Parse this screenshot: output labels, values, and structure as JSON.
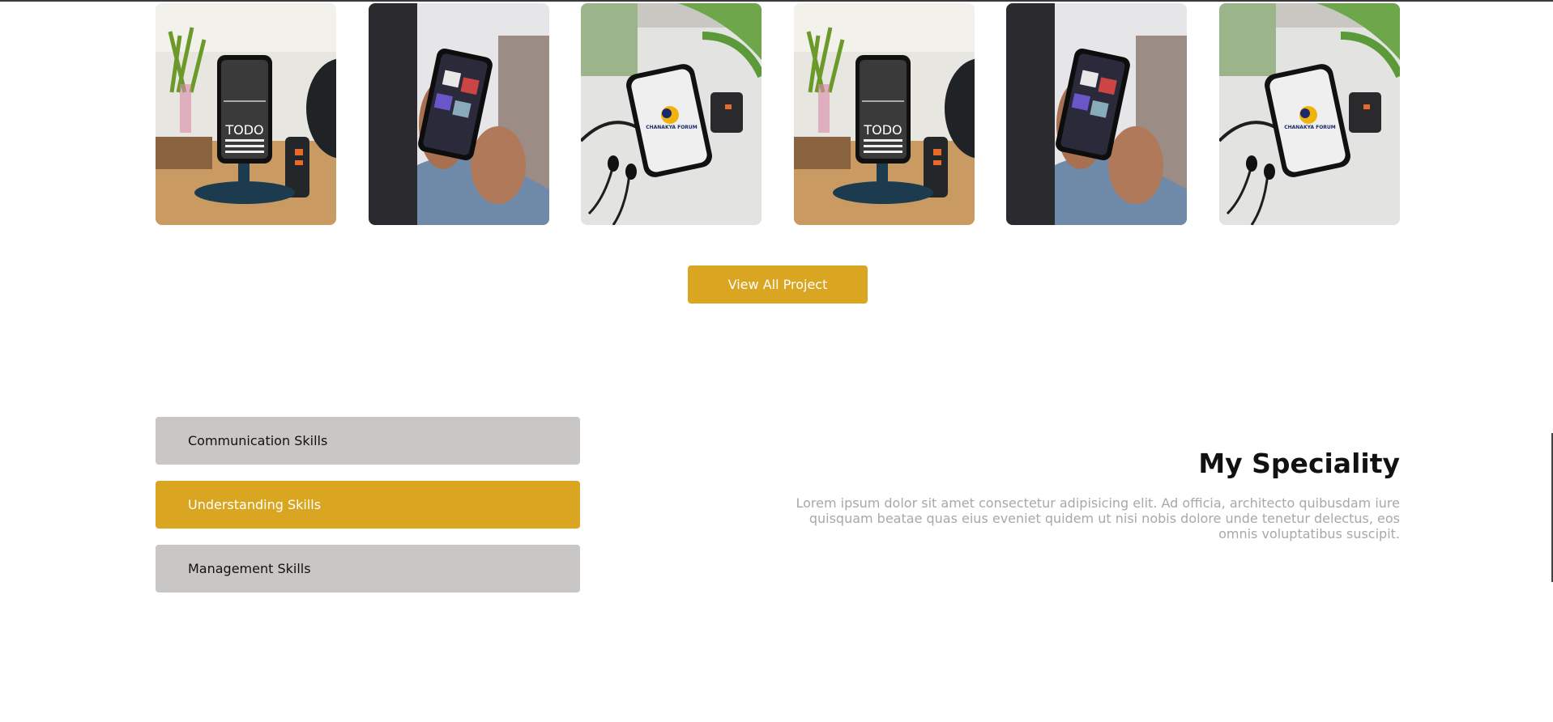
{
  "projects": {
    "cards": [
      {
        "alt": "todo-app-phone-on-stand",
        "screen_text": "TODO"
      },
      {
        "alt": "music-app-phone-in-hand",
        "screen_text": ""
      },
      {
        "alt": "chanakya-forum-phone-on-desk",
        "screen_text": "CHANAKYA FORUM"
      },
      {
        "alt": "todo-app-phone-on-stand",
        "screen_text": "TODO"
      },
      {
        "alt": "music-app-phone-in-hand",
        "screen_text": ""
      },
      {
        "alt": "chanakya-forum-phone-on-desk",
        "screen_text": "CHANAKYA FORUM"
      }
    ],
    "view_all_label": "View All Project"
  },
  "skills": {
    "items": [
      {
        "label": "Communication Skills",
        "active": false
      },
      {
        "label": "Understanding Skills",
        "active": true
      },
      {
        "label": "Management Skills",
        "active": false
      }
    ]
  },
  "speciality": {
    "title": "My Speciality",
    "body": "Lorem ipsum dolor sit amet consectetur adipisicing elit. Ad officia, architecto quibusdam iure quisquam beatae quas eius eveniet quidem ut nisi nobis dolore unde tenetur delectus, eos omnis voluptatibus suscipit."
  },
  "colors": {
    "accent": "#daa520",
    "inactive_tab": "#c8c7c6",
    "muted_text": "#a8a8a8"
  }
}
